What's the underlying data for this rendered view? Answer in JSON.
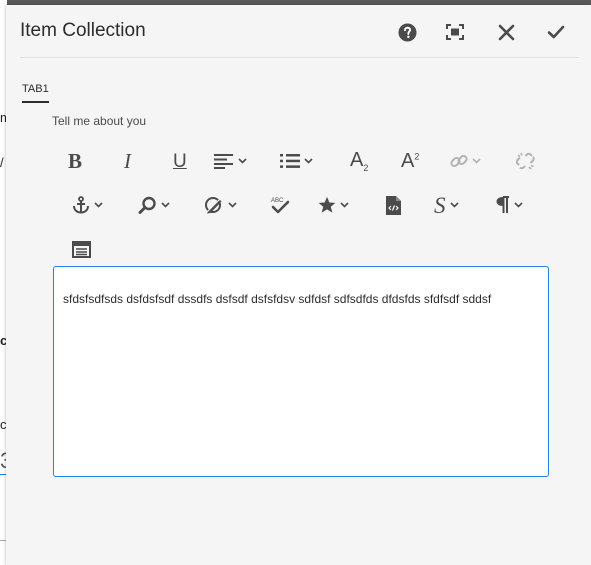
{
  "background": {
    "fragments": [
      "m",
      "/",
      "c",
      "c",
      "3"
    ]
  },
  "dialog": {
    "title": "Item Collection",
    "header_buttons": {
      "help_icon": "question-circle",
      "fullscreen_icon": "fullscreen",
      "close_icon": "close-x",
      "done_icon": "checkmark"
    },
    "tabs": [
      {
        "label": "TAB1",
        "selected": true
      }
    ],
    "field": {
      "label": "Tell me about you",
      "text": "sfdsfsdfsds dsfdsfsdf dssdfs dsfsdf dsfsfdsv sdfdsf sdfsdfds dfdsfds sfdfsdf sddsf"
    },
    "toolbar": {
      "bold": "B",
      "italic": "I",
      "underline": "U",
      "subscript": "A",
      "subscript_mark": "2",
      "superscript": "A",
      "superscript_mark": "2",
      "spellcheck_mark": "ABC",
      "styles": "S",
      "icons": [
        "bold",
        "italic",
        "underline",
        "align",
        "list",
        "subscript",
        "superscript",
        "link",
        "unlink",
        "anchor",
        "find",
        "edit",
        "spellcheck",
        "special-characters",
        "source-edit",
        "styles",
        "paragraph-format",
        "table"
      ]
    },
    "colors": {
      "accent": "#2680eb",
      "dialog_bg": "#f5f5f5",
      "text": "#2c2c2c",
      "icon": "#4b4b4b",
      "disabled_icon": "#b3b3b3"
    }
  }
}
